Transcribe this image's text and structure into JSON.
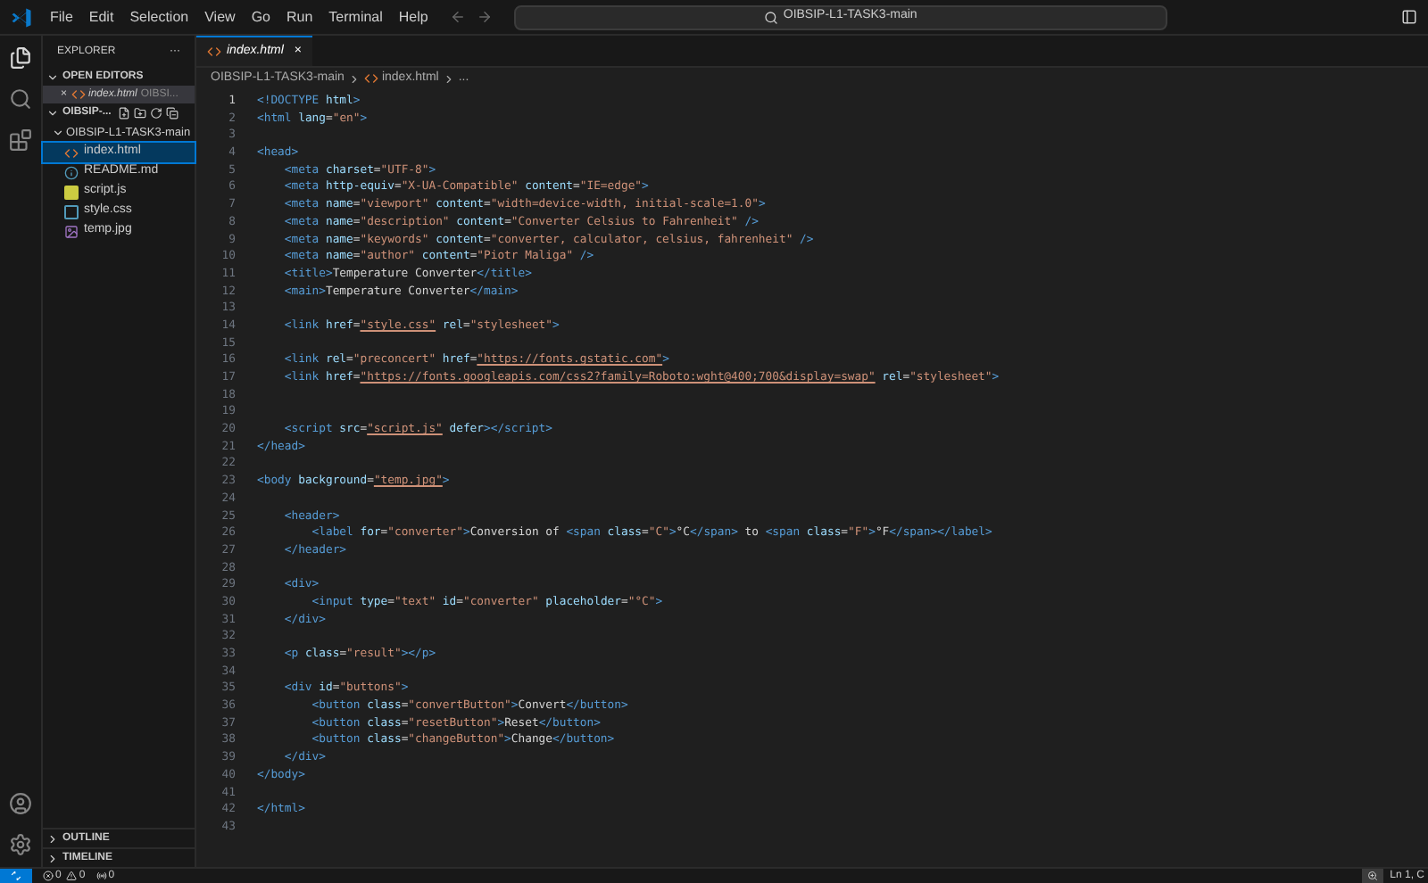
{
  "menu": [
    "File",
    "Edit",
    "Selection",
    "View",
    "Go",
    "Run",
    "Terminal",
    "Help"
  ],
  "command_center": {
    "value": "OIBSIP-L1-TASK3-main"
  },
  "sidebar": {
    "title": "EXPLORER",
    "more": "···",
    "open_editors": {
      "label": "OPEN EDITORS",
      "expanded": true,
      "items": [
        {
          "close": "×",
          "name": "index.html",
          "path": "OIBSI...",
          "kind": "html",
          "selected": true
        }
      ]
    },
    "folders": [
      {
        "label": "OIBSIP-...",
        "expanded": true,
        "children": [
          {
            "label": "OIBSIP-L1-TASK3-main",
            "expanded": true,
            "children": [
              {
                "label": "index.html",
                "kind": "html",
                "selected": true
              },
              {
                "label": "README.md",
                "kind": "info",
                "selected": false
              },
              {
                "label": "script.js",
                "kind": "js",
                "selected": false
              },
              {
                "label": "style.css",
                "kind": "css",
                "selected": false
              },
              {
                "label": "temp.jpg",
                "kind": "image",
                "selected": false
              }
            ]
          }
        ]
      }
    ],
    "bottom_sections": [
      {
        "label": "OUTLINE",
        "expanded": false
      },
      {
        "label": "TIMELINE",
        "expanded": false
      }
    ]
  },
  "tabs": [
    {
      "label": "index.html",
      "close": "×",
      "selected": true
    }
  ],
  "breadcrumb": [
    "OIBSIP-L1-TASK3-main",
    "index.html",
    "..."
  ],
  "editor": {
    "lines": [
      {
        "n": "1",
        "tokens": [
          {
            "kind": "tag",
            "text": "<!DOCTYPE"
          },
          {
            "kind": "attr",
            "text": " html"
          },
          {
            "kind": "tag",
            "text": ">"
          }
        ]
      },
      {
        "n": "2",
        "tokens": [
          {
            "kind": "tag",
            "text": "<html"
          },
          {
            "kind": "attr",
            "text": " lang"
          },
          {
            "kind": "plain",
            "text": "="
          },
          {
            "kind": "string",
            "text": "\"en\""
          },
          {
            "kind": "tag",
            "text": ">"
          }
        ]
      },
      {
        "n": "3"
      },
      {
        "n": "4",
        "tokens": [
          {
            "kind": "tag",
            "text": "<head>"
          }
        ]
      },
      {
        "n": "5",
        "tokens": [
          {
            "kind": "tag",
            "text": "    <meta"
          },
          {
            "kind": "attr",
            "text": " charset"
          },
          {
            "kind": "plain",
            "text": "="
          },
          {
            "kind": "string",
            "text": "\"UTF-8\""
          },
          {
            "kind": "tag",
            "text": ">"
          }
        ]
      },
      {
        "n": "6",
        "tokens": [
          {
            "kind": "tag",
            "text": "    <meta"
          },
          {
            "kind": "attr",
            "text": " http-equiv"
          },
          {
            "kind": "plain",
            "text": "="
          },
          {
            "kind": "string",
            "text": "\"X-UA-Compatible\""
          },
          {
            "kind": "attr",
            "text": " content"
          },
          {
            "kind": "plain",
            "text": "="
          },
          {
            "kind": "string",
            "text": "\"IE=edge\""
          },
          {
            "kind": "tag",
            "text": ">"
          }
        ]
      },
      {
        "n": "7",
        "tokens": [
          {
            "kind": "tag",
            "text": "    <meta"
          },
          {
            "kind": "attr",
            "text": " name"
          },
          {
            "kind": "plain",
            "text": "="
          },
          {
            "kind": "string",
            "text": "\"viewport\""
          },
          {
            "kind": "attr",
            "text": " content"
          },
          {
            "kind": "plain",
            "text": "="
          },
          {
            "kind": "string",
            "text": "\"width=device-width, initial-scale=1.0\""
          },
          {
            "kind": "tag",
            "text": ">"
          }
        ]
      },
      {
        "n": "8",
        "tokens": [
          {
            "kind": "tag",
            "text": "    <meta"
          },
          {
            "kind": "attr",
            "text": " name"
          },
          {
            "kind": "plain",
            "text": "="
          },
          {
            "kind": "string",
            "text": "\"description\""
          },
          {
            "kind": "attr",
            "text": " content"
          },
          {
            "kind": "plain",
            "text": "="
          },
          {
            "kind": "string",
            "text": "\"Converter Celsius to Fahrenheit\""
          },
          {
            "kind": "tag",
            "text": " />"
          }
        ]
      },
      {
        "n": "9",
        "tokens": [
          {
            "kind": "tag",
            "text": "    <meta"
          },
          {
            "kind": "attr",
            "text": " name"
          },
          {
            "kind": "plain",
            "text": "="
          },
          {
            "kind": "string",
            "text": "\"keywords\""
          },
          {
            "kind": "attr",
            "text": " content"
          },
          {
            "kind": "plain",
            "text": "="
          },
          {
            "kind": "string",
            "text": "\"converter, calculator, celsius, fahrenheit\""
          },
          {
            "kind": "tag",
            "text": " />"
          }
        ]
      },
      {
        "n": "10",
        "tokens": [
          {
            "kind": "tag",
            "text": "    <meta"
          },
          {
            "kind": "attr",
            "text": " name"
          },
          {
            "kind": "plain",
            "text": "="
          },
          {
            "kind": "string",
            "text": "\"author\""
          },
          {
            "kind": "attr",
            "text": " content"
          },
          {
            "kind": "plain",
            "text": "="
          },
          {
            "kind": "string",
            "text": "\"Piotr Maliga\""
          },
          {
            "kind": "tag",
            "text": " />"
          }
        ]
      },
      {
        "n": "11",
        "tokens": [
          {
            "kind": "tag",
            "text": "    <title>"
          },
          {
            "kind": "plain",
            "text": "Temperature Converter"
          },
          {
            "kind": "tag",
            "text": "</title>"
          }
        ]
      },
      {
        "n": "12",
        "tokens": [
          {
            "kind": "tag",
            "text": "    <main>"
          },
          {
            "kind": "plain",
            "text": "Temperature Converter"
          },
          {
            "kind": "tag",
            "text": "</main>"
          }
        ]
      },
      {
        "n": "13"
      },
      {
        "n": "14",
        "tokens": [
          {
            "kind": "tag",
            "text": "    <link"
          },
          {
            "kind": "attr",
            "text": " href"
          },
          {
            "kind": "plain",
            "text": "="
          },
          {
            "kind": "link",
            "text": "\"style.css\""
          },
          {
            "kind": "attr",
            "text": " rel"
          },
          {
            "kind": "plain",
            "text": "="
          },
          {
            "kind": "string",
            "text": "\"stylesheet\""
          },
          {
            "kind": "tag",
            "text": ">"
          }
        ]
      },
      {
        "n": "15"
      },
      {
        "n": "16",
        "tokens": [
          {
            "kind": "tag",
            "text": "    <link"
          },
          {
            "kind": "attr",
            "text": " rel"
          },
          {
            "kind": "plain",
            "text": "="
          },
          {
            "kind": "string",
            "text": "\"preconcert\""
          },
          {
            "kind": "attr",
            "text": " href"
          },
          {
            "kind": "plain",
            "text": "="
          },
          {
            "kind": "link",
            "text": "\"https://fonts.gstatic.com\""
          },
          {
            "kind": "tag",
            "text": ">"
          }
        ]
      },
      {
        "n": "17",
        "tokens": [
          {
            "kind": "tag",
            "text": "    <link"
          },
          {
            "kind": "attr",
            "text": " href"
          },
          {
            "kind": "plain",
            "text": "="
          },
          {
            "kind": "link",
            "text": "\"https://fonts.googleapis.com/css2?family=Roboto:wght@400;700&display=swap\""
          },
          {
            "kind": "attr",
            "text": " rel"
          },
          {
            "kind": "plain",
            "text": "="
          },
          {
            "kind": "string",
            "text": "\"stylesheet\""
          },
          {
            "kind": "tag",
            "text": ">"
          }
        ]
      },
      {
        "n": "18"
      },
      {
        "n": "19"
      },
      {
        "n": "20",
        "tokens": [
          {
            "kind": "tag",
            "text": "    <script"
          },
          {
            "kind": "attr",
            "text": " src"
          },
          {
            "kind": "plain",
            "text": "="
          },
          {
            "kind": "link",
            "text": "\"script.js\""
          },
          {
            "kind": "attr",
            "text": " defer"
          },
          {
            "kind": "tag",
            "text": "></script>"
          }
        ]
      },
      {
        "n": "21",
        "tokens": [
          {
            "kind": "tag",
            "text": "</head>"
          }
        ]
      },
      {
        "n": "22"
      },
      {
        "n": "23",
        "tokens": [
          {
            "kind": "tag",
            "text": "<body"
          },
          {
            "kind": "attr",
            "text": " background"
          },
          {
            "kind": "plain",
            "text": "="
          },
          {
            "kind": "link",
            "text": "\"temp.jpg\""
          },
          {
            "kind": "tag",
            "text": ">"
          }
        ]
      },
      {
        "n": "24"
      },
      {
        "n": "25",
        "tokens": [
          {
            "kind": "tag",
            "text": "    <header>"
          }
        ]
      },
      {
        "n": "26",
        "tokens": [
          {
            "kind": "tag",
            "text": "        <label"
          },
          {
            "kind": "attr",
            "text": " for"
          },
          {
            "kind": "plain",
            "text": "="
          },
          {
            "kind": "string",
            "text": "\"converter\""
          },
          {
            "kind": "tag",
            "text": ">"
          },
          {
            "kind": "plain",
            "text": "Conversion of "
          },
          {
            "kind": "tag",
            "text": "<span"
          },
          {
            "kind": "attr",
            "text": " class"
          },
          {
            "kind": "plain",
            "text": "="
          },
          {
            "kind": "string",
            "text": "\"C\""
          },
          {
            "kind": "tag",
            "text": ">"
          },
          {
            "kind": "plain",
            "text": "°C"
          },
          {
            "kind": "tag",
            "text": "</span>"
          },
          {
            "kind": "plain",
            "text": " to "
          },
          {
            "kind": "tag",
            "text": "<span"
          },
          {
            "kind": "attr",
            "text": " class"
          },
          {
            "kind": "plain",
            "text": "="
          },
          {
            "kind": "string",
            "text": "\"F\""
          },
          {
            "kind": "tag",
            "text": ">"
          },
          {
            "kind": "plain",
            "text": "°F"
          },
          {
            "kind": "tag",
            "text": "</span></label>"
          }
        ]
      },
      {
        "n": "27",
        "tokens": [
          {
            "kind": "tag",
            "text": "    </header>"
          }
        ]
      },
      {
        "n": "28"
      },
      {
        "n": "29",
        "tokens": [
          {
            "kind": "tag",
            "text": "    <div>"
          }
        ]
      },
      {
        "n": "30",
        "tokens": [
          {
            "kind": "tag",
            "text": "        <input"
          },
          {
            "kind": "attr",
            "text": " type"
          },
          {
            "kind": "plain",
            "text": "="
          },
          {
            "kind": "string",
            "text": "\"text\""
          },
          {
            "kind": "attr",
            "text": " id"
          },
          {
            "kind": "plain",
            "text": "="
          },
          {
            "kind": "string",
            "text": "\"converter\""
          },
          {
            "kind": "attr",
            "text": " placeholder"
          },
          {
            "kind": "plain",
            "text": "="
          },
          {
            "kind": "string",
            "text": "\"°C\""
          },
          {
            "kind": "tag",
            "text": ">"
          }
        ]
      },
      {
        "n": "31",
        "tokens": [
          {
            "kind": "tag",
            "text": "    </div>"
          }
        ]
      },
      {
        "n": "32"
      },
      {
        "n": "33",
        "tokens": [
          {
            "kind": "tag",
            "text": "    <p"
          },
          {
            "kind": "attr",
            "text": " class"
          },
          {
            "kind": "plain",
            "text": "="
          },
          {
            "kind": "string",
            "text": "\"result\""
          },
          {
            "kind": "tag",
            "text": "></p>"
          }
        ]
      },
      {
        "n": "34"
      },
      {
        "n": "35",
        "tokens": [
          {
            "kind": "tag",
            "text": "    <div"
          },
          {
            "kind": "attr",
            "text": " id"
          },
          {
            "kind": "plain",
            "text": "="
          },
          {
            "kind": "string",
            "text": "\"buttons\""
          },
          {
            "kind": "tag",
            "text": ">"
          }
        ]
      },
      {
        "n": "36",
        "tokens": [
          {
            "kind": "tag",
            "text": "        <button"
          },
          {
            "kind": "attr",
            "text": " class"
          },
          {
            "kind": "plain",
            "text": "="
          },
          {
            "kind": "string",
            "text": "\"convertButton\""
          },
          {
            "kind": "tag",
            "text": ">"
          },
          {
            "kind": "plain",
            "text": "Convert"
          },
          {
            "kind": "tag",
            "text": "</button>"
          }
        ]
      },
      {
        "n": "37",
        "tokens": [
          {
            "kind": "tag",
            "text": "        <button"
          },
          {
            "kind": "attr",
            "text": " class"
          },
          {
            "kind": "plain",
            "text": "="
          },
          {
            "kind": "string",
            "text": "\"resetButton\""
          },
          {
            "kind": "tag",
            "text": ">"
          },
          {
            "kind": "plain",
            "text": "Reset"
          },
          {
            "kind": "tag",
            "text": "</button>"
          }
        ]
      },
      {
        "n": "38",
        "tokens": [
          {
            "kind": "tag",
            "text": "        <button"
          },
          {
            "kind": "attr",
            "text": " class"
          },
          {
            "kind": "plain",
            "text": "="
          },
          {
            "kind": "string",
            "text": "\"changeButton\""
          },
          {
            "kind": "tag",
            "text": ">"
          },
          {
            "kind": "plain",
            "text": "Change"
          },
          {
            "kind": "tag",
            "text": "</button>"
          }
        ]
      },
      {
        "n": "39",
        "tokens": [
          {
            "kind": "tag",
            "text": "    </div>"
          }
        ]
      },
      {
        "n": "40",
        "tokens": [
          {
            "kind": "tag",
            "text": "</body>"
          }
        ]
      },
      {
        "n": "41"
      },
      {
        "n": "42",
        "tokens": [
          {
            "kind": "tag",
            "text": "</html>"
          }
        ]
      },
      {
        "n": "43"
      }
    ]
  },
  "status_bar": {
    "errors": "0",
    "warnings": "0",
    "ports": "0",
    "position": "Ln 1, C"
  }
}
